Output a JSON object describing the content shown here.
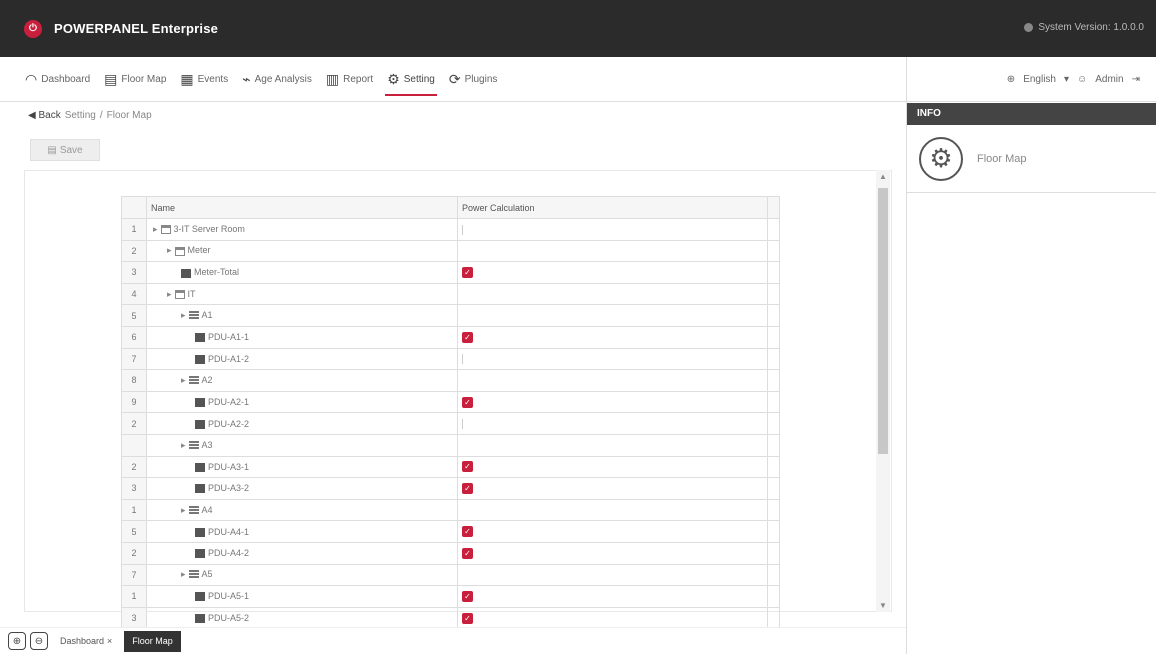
{
  "app": {
    "logo_glyph": "⏻",
    "title": "POWERPANEL Enterprise",
    "system_version": "System Version: 1.0.0.0"
  },
  "nav": {
    "items": [
      {
        "icon": "◠",
        "label": "Dashboard"
      },
      {
        "icon": "▤",
        "label": "Floor Map"
      },
      {
        "icon": "▦",
        "label": "Events"
      },
      {
        "icon": "⌁",
        "label": "Age Analysis"
      },
      {
        "icon": "▥",
        "label": "Report"
      },
      {
        "icon": "⚙",
        "label": "Setting"
      },
      {
        "icon": "⟳",
        "label": "Plugins"
      }
    ],
    "language": "English",
    "user": "Admin"
  },
  "breadcrumb": {
    "back": "◀ Back",
    "sep": "/",
    "path": [
      "Setting",
      "Floor Map"
    ]
  },
  "toolbar": {
    "save_label": "Save",
    "save_icon": "▤"
  },
  "table": {
    "headers": {
      "name": "Name",
      "power_calc": "Power Calculation"
    },
    "rows": [
      {
        "num": "1",
        "indent": 0,
        "expand": "▸",
        "icon": "folder",
        "name": "3-IT Server Room",
        "checked": false
      },
      {
        "num": "2",
        "indent": 1,
        "expand": "▸",
        "icon": "folder",
        "name": "Meter",
        "checked": null
      },
      {
        "num": "3",
        "indent": 2,
        "expand": "",
        "icon": "dev",
        "name": "Meter-Total",
        "checked": true
      },
      {
        "num": "4",
        "indent": 1,
        "expand": "▸",
        "icon": "folder",
        "name": "IT",
        "checked": null
      },
      {
        "num": "5",
        "indent": 2,
        "expand": "▸",
        "icon": "rack",
        "name": "A1",
        "checked": null
      },
      {
        "num": "6",
        "indent": 3,
        "expand": "",
        "icon": "dev",
        "name": "PDU-A1-1",
        "checked": true
      },
      {
        "num": "7",
        "indent": 3,
        "expand": "",
        "icon": "dev",
        "name": "PDU-A1-2",
        "checked": false
      },
      {
        "num": "8",
        "indent": 2,
        "expand": "▸",
        "icon": "rack",
        "name": "A2",
        "checked": null
      },
      {
        "num": "9",
        "indent": 3,
        "expand": "",
        "icon": "dev",
        "name": "PDU-A2-1",
        "checked": true
      },
      {
        "num": "2",
        "indent": 3,
        "expand": "",
        "icon": "dev",
        "name": "PDU-A2-2",
        "checked": false
      },
      {
        "num": "",
        "indent": 2,
        "expand": "▸",
        "icon": "rack",
        "name": "A3",
        "checked": null
      },
      {
        "num": "2",
        "indent": 3,
        "expand": "",
        "icon": "dev",
        "name": "PDU-A3-1",
        "checked": true
      },
      {
        "num": "3",
        "indent": 3,
        "expand": "",
        "icon": "dev",
        "name": "PDU-A3-2",
        "checked": true
      },
      {
        "num": "1",
        "indent": 2,
        "expand": "▸",
        "icon": "rack",
        "name": "A4",
        "checked": null
      },
      {
        "num": "5",
        "indent": 3,
        "expand": "",
        "icon": "dev",
        "name": "PDU-A4-1",
        "checked": true
      },
      {
        "num": "2",
        "indent": 3,
        "expand": "",
        "icon": "dev",
        "name": "PDU-A4-2",
        "checked": true
      },
      {
        "num": "7",
        "indent": 2,
        "expand": "▸",
        "icon": "rack",
        "name": "A5",
        "checked": null
      },
      {
        "num": "1",
        "indent": 3,
        "expand": "",
        "icon": "dev",
        "name": "PDU-A5-1",
        "checked": true
      },
      {
        "num": "3",
        "indent": 3,
        "expand": "",
        "icon": "dev",
        "name": "PDU-A5-2",
        "checked": true
      }
    ]
  },
  "info": {
    "header": "INFO",
    "label": "Floor Map"
  },
  "bottom": {
    "tabs": [
      {
        "label": "Dashboard",
        "active": false
      },
      {
        "label": "Floor Map",
        "active": true
      }
    ]
  },
  "colors": {
    "accent": "#c8203c",
    "topbar": "#2b2b2b"
  }
}
